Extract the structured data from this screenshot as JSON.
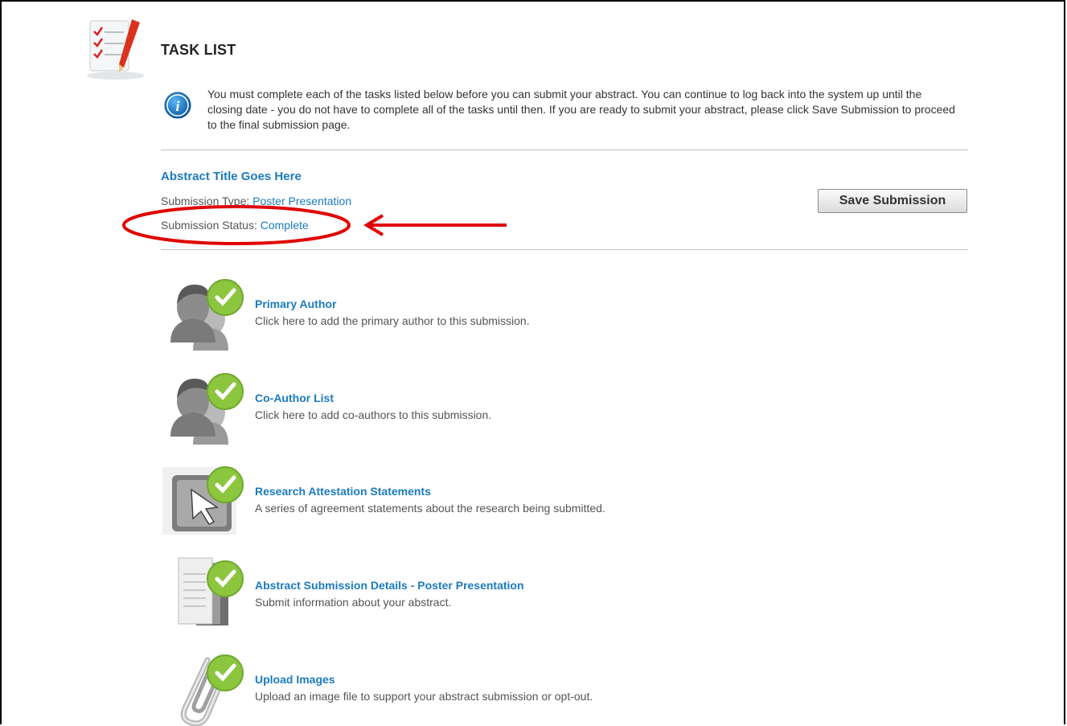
{
  "page": {
    "title": "TASK LIST",
    "info_text": "You must complete each of the tasks listed below before you can submit your abstract. You can continue to log back into the system up until the closing date - you do not have to complete all of the tasks until then. If you are ready to submit your abstract, please click Save Submission to proceed to the final submission page."
  },
  "submission": {
    "abstract_title": "Abstract Title Goes Here",
    "type_label": "Submission Type:",
    "type_value": "Poster Presentation",
    "status_label": "Submission Status:",
    "status_value": "Complete",
    "save_label": "Save Submission"
  },
  "tasks": [
    {
      "title": "Primary Author",
      "description": "Click here to add the primary author to this submission.",
      "icon": "person-check-icon"
    },
    {
      "title": "Co-Author List",
      "description": "Click here to add co-authors to this submission.",
      "icon": "person-check-icon"
    },
    {
      "title": "Research Attestation Statements",
      "description": "A series of agreement statements about the research being submitted.",
      "icon": "cursor-check-icon"
    },
    {
      "title": "Abstract Submission Details - Poster Presentation",
      "description": "Submit information about your abstract.",
      "icon": "document-check-icon"
    },
    {
      "title": "Upload Images",
      "description": "Upload an image file to support your abstract submission or opt-out.",
      "icon": "paperclip-check-icon"
    }
  ],
  "colors": {
    "link": "#1b7bbf",
    "check": "#8cc63f",
    "annotation": "#e00000"
  }
}
